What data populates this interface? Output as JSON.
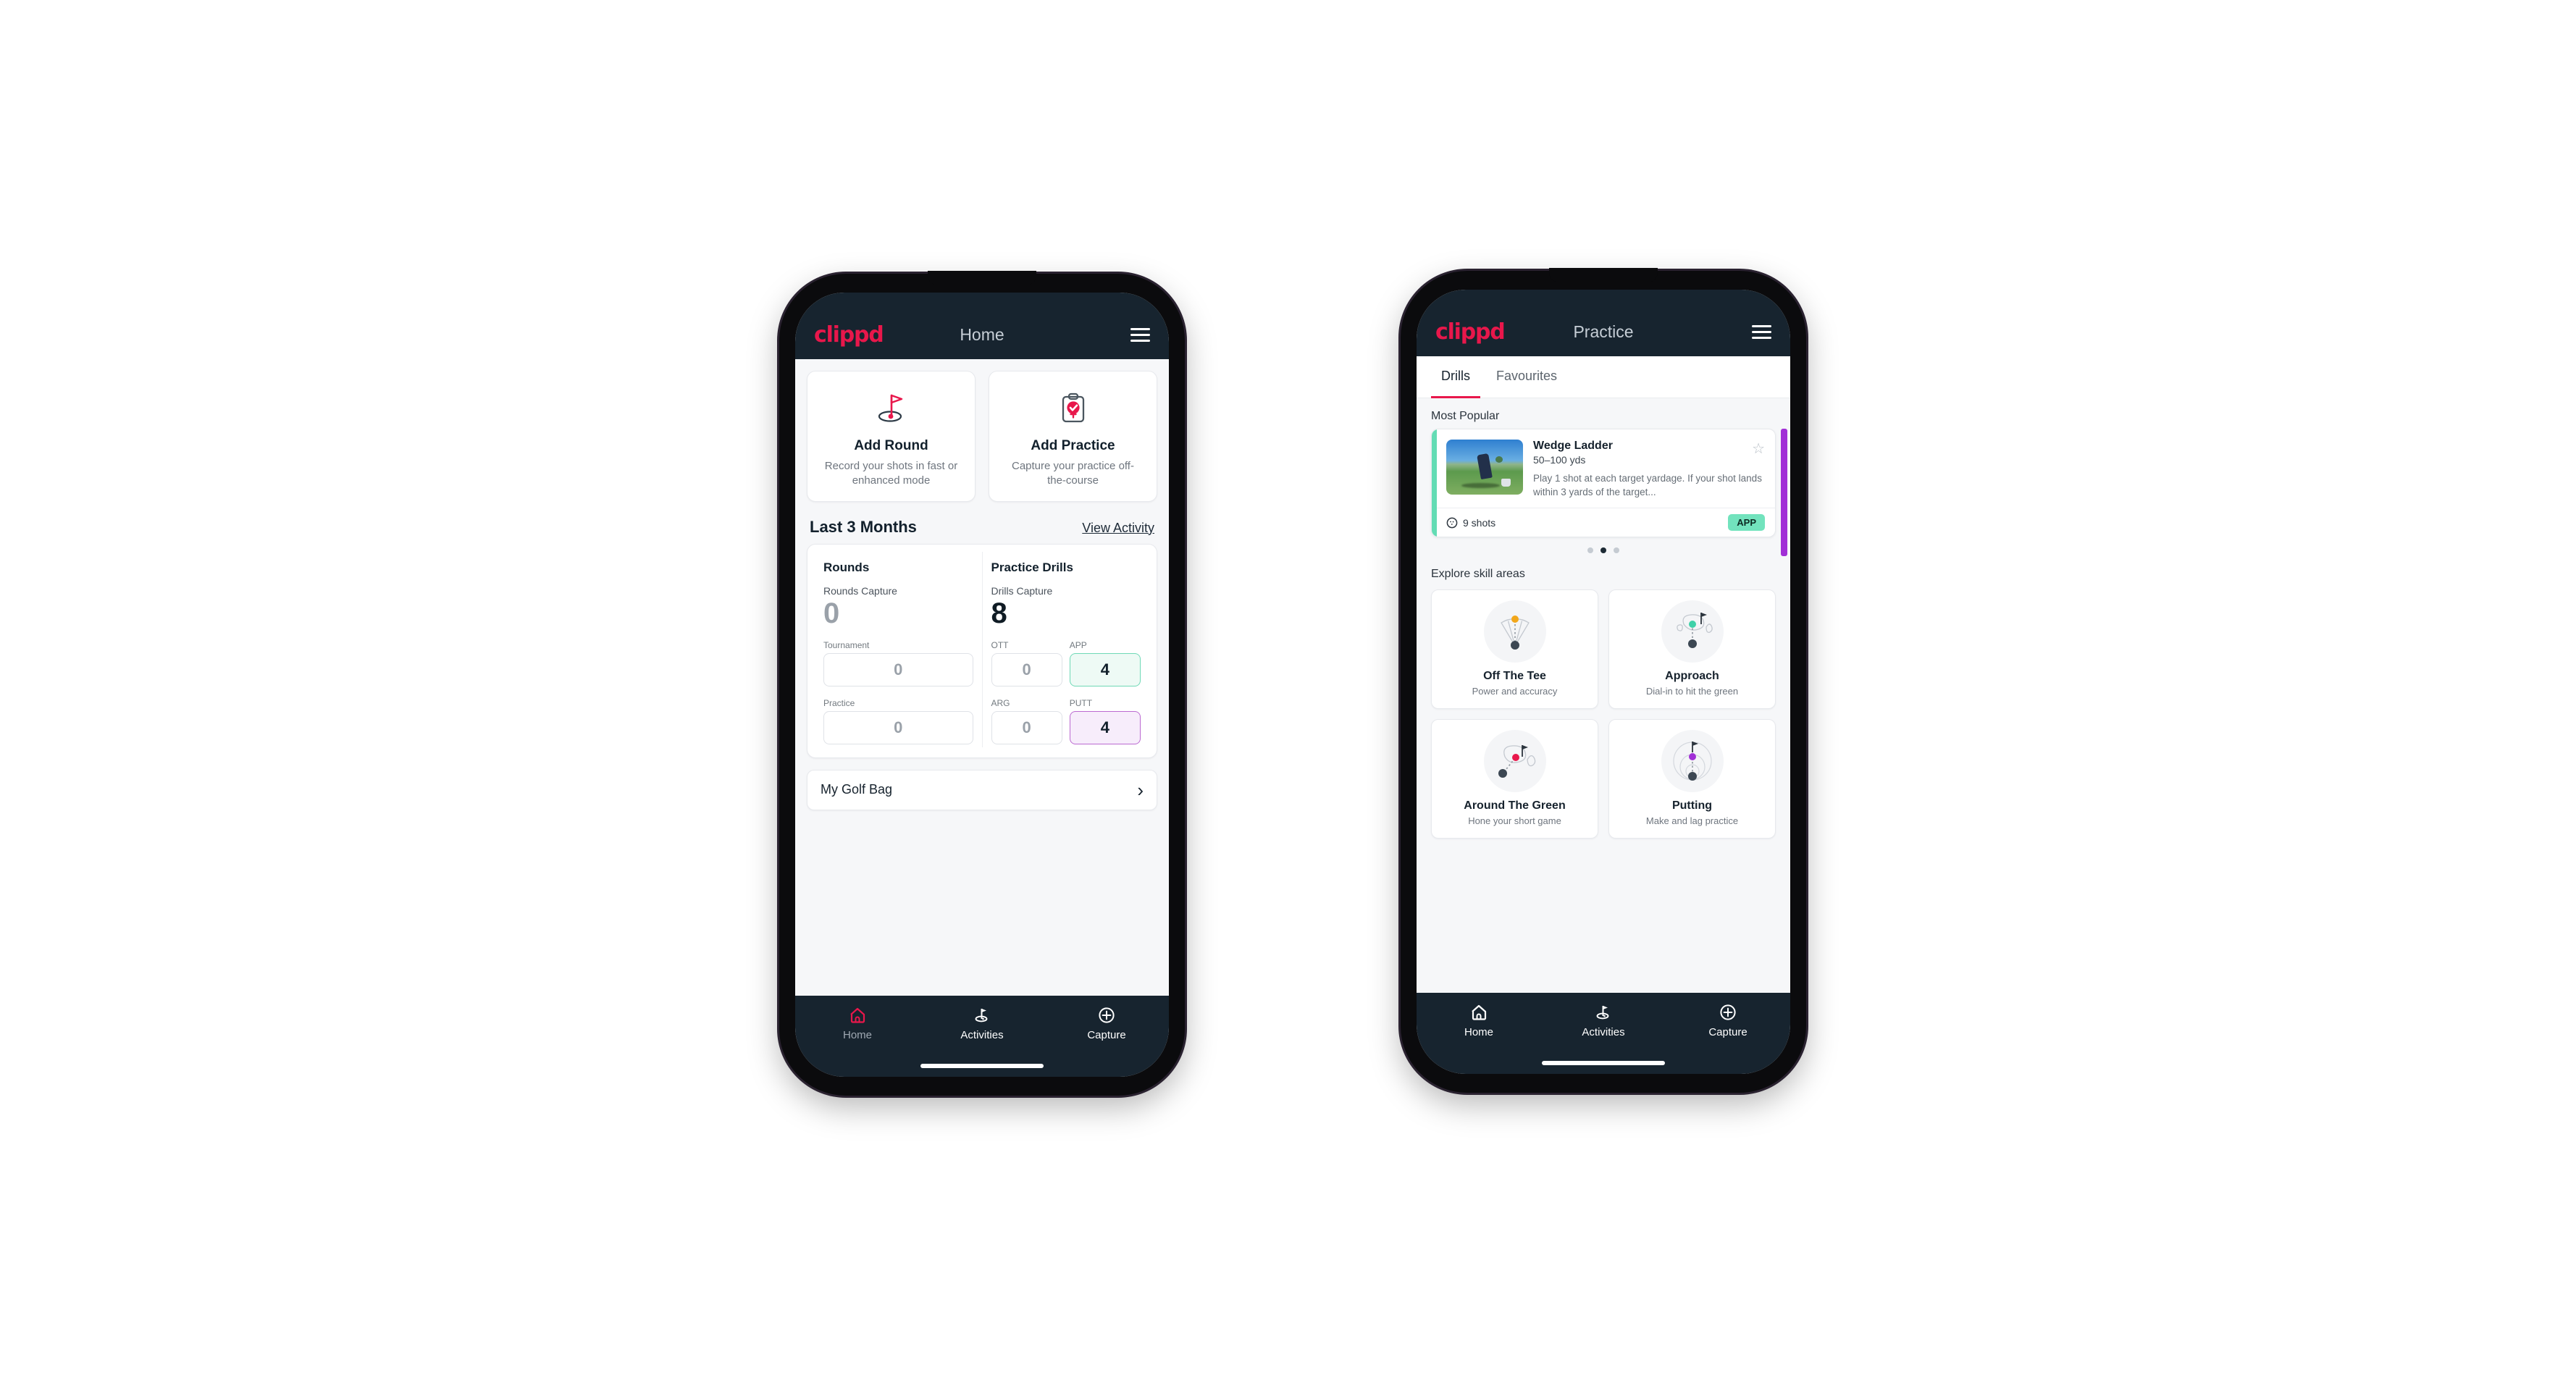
{
  "brand": "clippd",
  "home": {
    "title": "Home",
    "actions": [
      {
        "title": "Add Round",
        "sub": "Record your shots in fast or enhanced mode",
        "icon": "golf-flag-icon"
      },
      {
        "title": "Add Practice",
        "sub": "Capture your practice off-the-course",
        "icon": "clipboard-check-icon"
      }
    ],
    "section": {
      "title": "Last 3 Months",
      "link": "View Activity"
    },
    "rounds": {
      "title": "Rounds",
      "capture_label": "Rounds Capture",
      "capture_value": "0",
      "fields": [
        {
          "label": "Tournament",
          "value": "0"
        },
        {
          "label": "Practice",
          "value": "0"
        }
      ]
    },
    "drills": {
      "title": "Practice Drills",
      "capture_label": "Drills Capture",
      "capture_value": "8",
      "cells": [
        {
          "label": "OTT",
          "value": "0",
          "state": "empty"
        },
        {
          "label": "APP",
          "value": "4",
          "state": "green"
        },
        {
          "label": "ARG",
          "value": "0",
          "state": "empty"
        },
        {
          "label": "PUTT",
          "value": "4",
          "state": "purple"
        }
      ]
    },
    "golf_bag": {
      "label": "My Golf Bag",
      "chevron": "›"
    }
  },
  "practice": {
    "title": "Practice",
    "tabs": [
      {
        "label": "Drills",
        "active": true
      },
      {
        "label": "Favourites",
        "active": false
      }
    ],
    "most_popular_label": "Most Popular",
    "drill": {
      "title": "Wedge Ladder",
      "yardage": "50–100 yds",
      "description": "Play 1 shot at each target yardage. If your shot lands within 3 yards of the target...",
      "shots": "9 shots",
      "badge": "APP",
      "star": "☆",
      "accent_color": "#63dcb4",
      "next_accent_color": "#a12fd6"
    },
    "carousel_dots": 3,
    "carousel_active": 1,
    "skill_label": "Explore skill areas",
    "skills": [
      {
        "title": "Off The Tee",
        "sub": "Power and accuracy",
        "icon": "tee-fan-icon",
        "dot": "#f2a71b"
      },
      {
        "title": "Approach",
        "sub": "Dial-in to hit the green",
        "icon": "green-approach-icon",
        "dot": "#3ed1a8"
      },
      {
        "title": "Around The Green",
        "sub": "Hone your short game",
        "icon": "chip-green-icon",
        "dot": "#e8174b"
      },
      {
        "title": "Putting",
        "sub": "Make and lag practice",
        "icon": "putting-rings-icon",
        "dot": "#a12fd6"
      }
    ]
  },
  "nav": [
    {
      "label": "Home",
      "icon": "home-icon"
    },
    {
      "label": "Activities",
      "icon": "golf-flag-icon"
    },
    {
      "label": "Capture",
      "icon": "plus-circle-icon"
    }
  ],
  "colors": {
    "brand_pink": "#e8174b",
    "header_navy": "#17242f",
    "green": "#63dcb4",
    "purple": "#a12fd6"
  }
}
